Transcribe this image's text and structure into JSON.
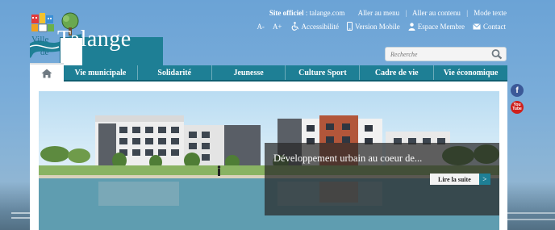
{
  "logo": {
    "ville": "Ville",
    "de": "de",
    "name": "Talange"
  },
  "topbar": {
    "site_label": "Site officiel",
    "site_domain": " : talange.com",
    "goto_menu": "Aller au menu",
    "goto_content": "Aller au contenu",
    "text_mode": "Mode texte"
  },
  "subbar": {
    "font_decrease": "A-",
    "font_increase": "A+",
    "accessibility": "Accessibilité",
    "mobile": "Version Mobile",
    "member": "Espace Membre",
    "contact": "Contact"
  },
  "search": {
    "placeholder": "Recherche"
  },
  "nav": {
    "items": [
      {
        "label": "Vie municipale"
      },
      {
        "label": "Solidarité"
      },
      {
        "label": "Jeunesse"
      },
      {
        "label": "Culture Sport"
      },
      {
        "label": "Cadre de vie"
      },
      {
        "label": "Vie économique"
      }
    ]
  },
  "hero": {
    "caption": "Développement urbain au coeur de...",
    "read_more": "Lire la suite",
    "read_more_arrow": ">"
  },
  "social": {
    "facebook": "f",
    "youtube_top": "You",
    "youtube_bottom": "Tube"
  },
  "colors": {
    "brand": "#1e7f95",
    "background": "#79acd9"
  }
}
